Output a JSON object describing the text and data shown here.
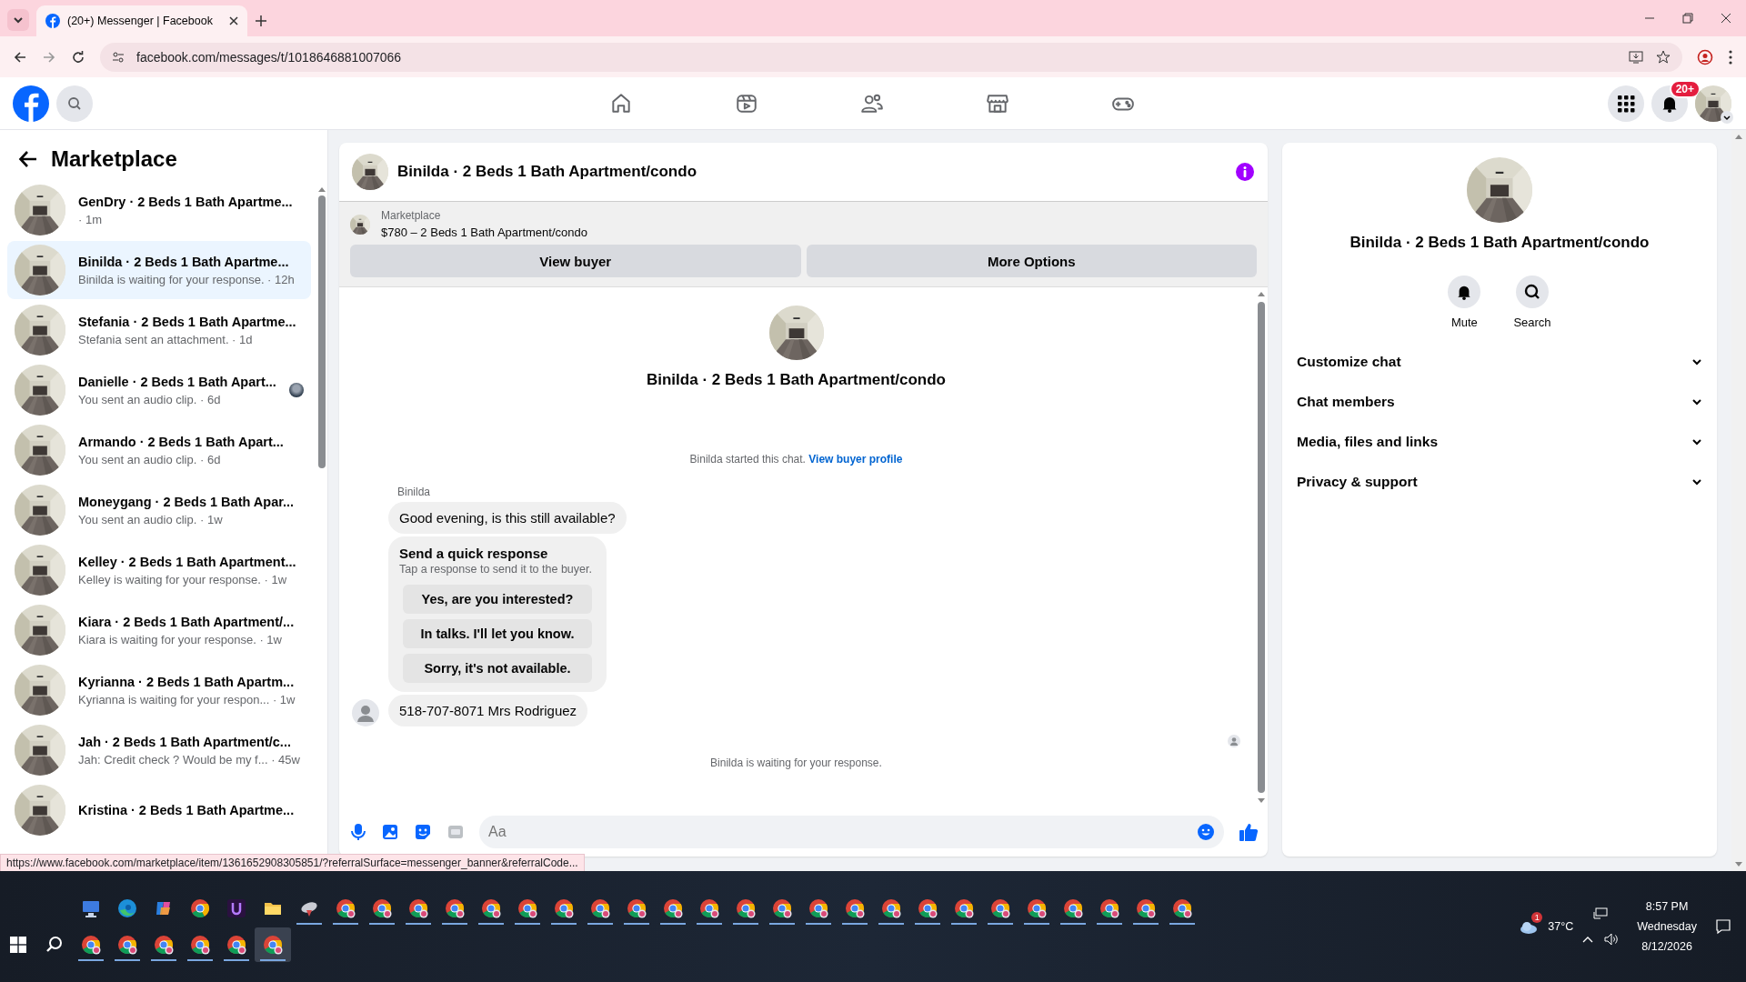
{
  "browser": {
    "tab_title": "(20+) Messenger | Facebook",
    "url": "facebook.com/messages/t/1018646881007066",
    "status_url": "https://www.facebook.com/marketplace/item/1361652908305851/?referralSurface=messenger_banner&referralCode..."
  },
  "header": {
    "notification_badge": "20+"
  },
  "sidebar": {
    "title": "Marketplace",
    "conversations": [
      {
        "name": "GenDry · 2 Beds 1 Bath Apartme...",
        "preview": "· 1m",
        "selected": false,
        "read_receipt": false
      },
      {
        "name": "Binilda · 2 Beds 1 Bath Apartme...",
        "preview": "Binilda is waiting for your response. · 12h",
        "selected": true,
        "read_receipt": false
      },
      {
        "name": "Stefania · 2 Beds 1 Bath Apartme...",
        "preview": "Stefania sent an attachment. · 1d",
        "selected": false,
        "read_receipt": false
      },
      {
        "name": "Danielle · 2 Beds 1 Bath Apart...",
        "preview": "You sent an audio clip. · 6d",
        "selected": false,
        "read_receipt": true
      },
      {
        "name": "Armando · 2 Beds 1 Bath Apart...",
        "preview": "You sent an audio clip. · 6d",
        "selected": false,
        "read_receipt": false
      },
      {
        "name": "Moneygang · 2 Beds 1 Bath Apar...",
        "preview": "You sent an audio clip. · 1w",
        "selected": false,
        "read_receipt": false
      },
      {
        "name": "Kelley · 2 Beds 1 Bath Apartment...",
        "preview": "Kelley is waiting for your response. · 1w",
        "selected": false,
        "read_receipt": false
      },
      {
        "name": "Kiara · 2 Beds 1 Bath Apartment/...",
        "preview": "Kiara is waiting for your response. · 1w",
        "selected": false,
        "read_receipt": false
      },
      {
        "name": "Kyrianna · 2 Beds 1 Bath Apartm...",
        "preview": "Kyrianna is waiting for your respon... · 1w",
        "selected": false,
        "read_receipt": false
      },
      {
        "name": "Jah · 2 Beds 1 Bath Apartment/c...",
        "preview": "Jah: Credit check ? Would be my f... · 45w",
        "selected": false,
        "read_receipt": false
      },
      {
        "name": "Kristina · 2 Beds 1 Bath Apartme...",
        "selected": false,
        "read_receipt": false
      }
    ]
  },
  "chat": {
    "title": "Binilda · 2 Beds 1 Bath Apartment/condo",
    "listing": {
      "source": "Marketplace",
      "summary": "$780 – 2 Beds 1 Bath Apartment/condo"
    },
    "actions": [
      "View buyer",
      "More Options"
    ],
    "intro_title": "Binilda · 2 Beds 1 Bath Apartment/condo",
    "started_text": "Binilda started this chat.",
    "started_link": "View buyer profile",
    "sender": "Binilda",
    "messages": [
      {
        "kind": "text",
        "text": "Good evening, is this still available?",
        "avatar": false
      },
      {
        "kind": "quick_response",
        "title": "Send a quick response",
        "subtitle": "Tap a response to send it to the buyer.",
        "options": [
          "Yes, are you interested?",
          "In talks. I'll let you know.",
          "Sorry, it's not available."
        ]
      },
      {
        "kind": "text",
        "text": "518-707-8071 Mrs Rodriguez",
        "avatar": true
      }
    ],
    "waiting": "Binilda is waiting for your response.",
    "composer": {
      "placeholder": "Aa"
    }
  },
  "details": {
    "title": "Binilda · 2 Beds 1 Bath Apartment/condo",
    "actions": [
      {
        "kind": "mute",
        "label": "Mute"
      },
      {
        "kind": "search",
        "label": "Search"
      }
    ],
    "sections": [
      {
        "label": "Customize chat",
        "expanded": false
      },
      {
        "label": "Chat members",
        "expanded": false
      },
      {
        "label": "Media, files and links",
        "expanded": false
      },
      {
        "label": "Privacy & support",
        "expanded": false
      }
    ]
  },
  "taskbar": {
    "pinned": [
      {
        "kind": "monitor",
        "running": false
      },
      {
        "kind": "edge",
        "running": false
      },
      {
        "kind": "copilot",
        "running": false
      },
      {
        "kind": "chrome",
        "running": false
      },
      {
        "kind": "app",
        "running": false
      },
      {
        "kind": "folder",
        "running": false
      },
      {
        "kind": "dish",
        "running": true
      },
      {
        "kind": "profile",
        "running": true
      },
      {
        "kind": "profile",
        "running": true
      },
      {
        "kind": "profile",
        "running": true
      },
      {
        "kind": "profile",
        "running": true
      },
      {
        "kind": "profile",
        "running": true
      },
      {
        "kind": "profile",
        "running": true
      },
      {
        "kind": "profile",
        "running": true
      },
      {
        "kind": "profile",
        "running": true
      },
      {
        "kind": "profile",
        "running": true
      },
      {
        "kind": "profile",
        "running": true
      },
      {
        "kind": "profile",
        "running": true
      },
      {
        "kind": "profile",
        "running": true
      },
      {
        "kind": "profile",
        "running": true
      },
      {
        "kind": "profile",
        "running": true
      },
      {
        "kind": "profile",
        "running": true
      },
      {
        "kind": "profile",
        "running": true
      },
      {
        "kind": "profile",
        "running": true
      },
      {
        "kind": "profile",
        "running": true
      },
      {
        "kind": "profile",
        "running": true
      },
      {
        "kind": "profile",
        "running": true
      },
      {
        "kind": "profile",
        "running": true
      },
      {
        "kind": "profile",
        "running": true
      },
      {
        "kind": "profile",
        "running": true
      },
      {
        "kind": "profile",
        "running": true
      }
    ],
    "second_row": [
      {
        "selected": false
      },
      {
        "selected": false
      },
      {
        "selected": false
      },
      {
        "selected": false
      },
      {
        "selected": false
      },
      {
        "selected": true
      }
    ],
    "weather_badge": "1",
    "temperature": "37°C",
    "time": "8:57 PM",
    "day": "Wednesday",
    "date": "8/12/2026"
  }
}
